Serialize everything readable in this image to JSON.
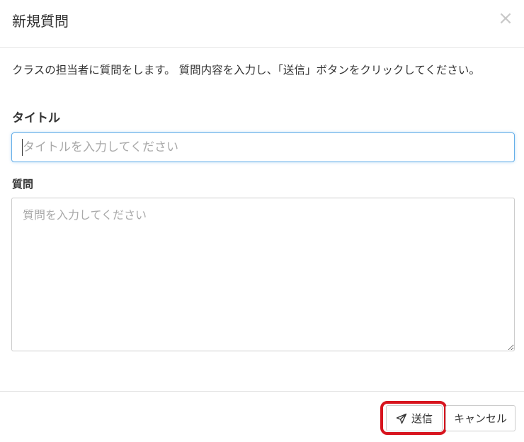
{
  "modal": {
    "title": "新規質問",
    "close_symbol": "×",
    "description": "クラスの担当者に質問をします。 質問内容を入力し、「送信」ボタンをクリックしてください。"
  },
  "form": {
    "title_label": "タイトル",
    "title_placeholder": "タイトルを入力してください",
    "title_value": "",
    "question_label": "質問",
    "question_placeholder": "質問を入力してください",
    "question_value": ""
  },
  "footer": {
    "send_label": "送信",
    "send_icon": "paper-plane-icon",
    "cancel_label": "キャンセル"
  },
  "colors": {
    "focus_border": "#66afe9",
    "highlight_ring": "#d7141e",
    "placeholder": "#a9a9a9",
    "divider": "#e5e5e5"
  }
}
